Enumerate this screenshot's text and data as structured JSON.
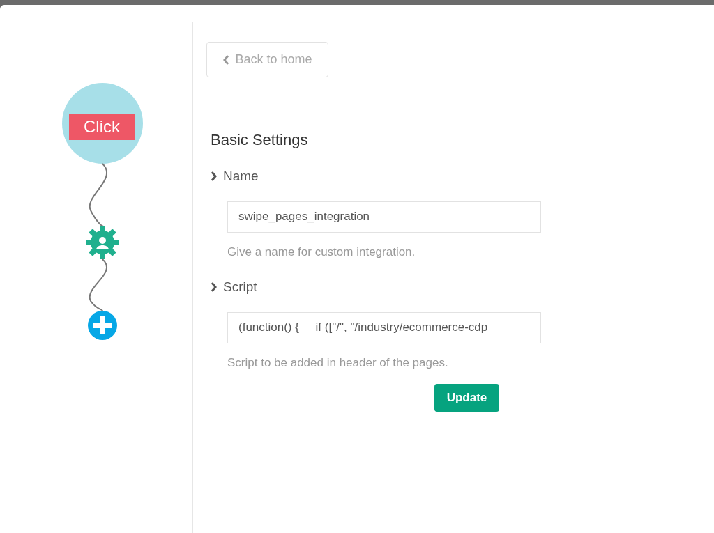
{
  "flow": {
    "trigger_label": "Click"
  },
  "back_button": {
    "label": "Back to home"
  },
  "heading": "Basic Settings",
  "fields": [
    {
      "label": "Name",
      "value": "swipe_pages_integration",
      "hint": "Give a name for custom integration."
    },
    {
      "label": "Script",
      "value": "(function() {     if ([\"/\", \"/industry/ecommerce-cdp",
      "hint": "Script to be added in header of the pages."
    }
  ],
  "submit_button": {
    "label": "Update"
  }
}
